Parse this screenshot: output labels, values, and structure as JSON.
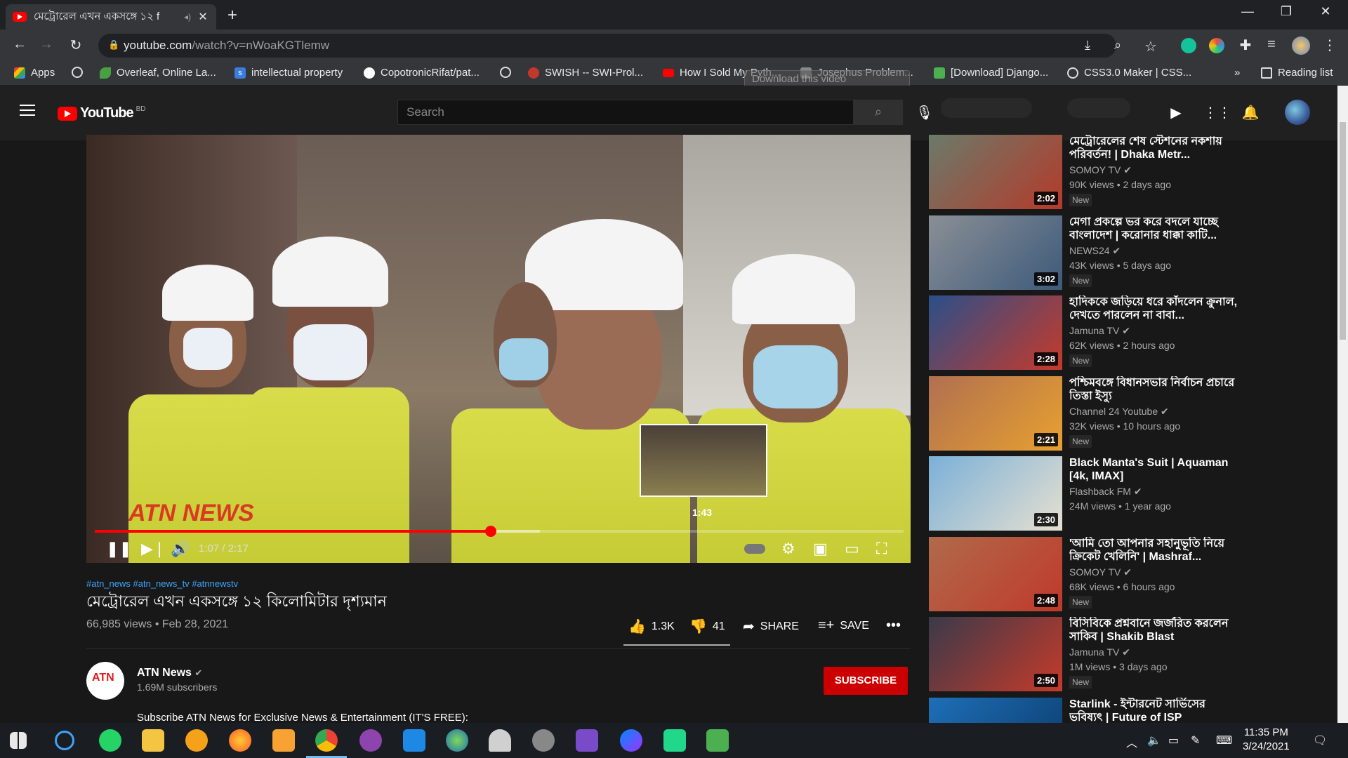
{
  "browser": {
    "tab_title": "মেট্রোরেল এখন একসঙ্গে ১২ f",
    "url_host": "youtube.com",
    "url_path": "/watch?v=nWoaKGTlemw",
    "reading_list": "Reading list",
    "bookmarks": [
      {
        "label": "Apps",
        "icon": "apps-grid-icon",
        "color": "#4285f4"
      },
      {
        "label": "",
        "icon": "globe-icon",
        "color": "#9aa0a6"
      },
      {
        "label": "Overleaf, Online La...",
        "icon": "overleaf-icon",
        "color": "#47a141"
      },
      {
        "label": "intellectual property",
        "icon": "s-icon",
        "color": "#3b7ddd"
      },
      {
        "label": "CopotronicRifat/pat...",
        "icon": "github-icon",
        "color": "#ffffff"
      },
      {
        "label": "",
        "icon": "globe-icon",
        "color": "#9aa0a6"
      },
      {
        "label": "SWISH -- SWI-Prol...",
        "icon": "swish-icon",
        "color": "#c0392b"
      },
      {
        "label": "How I Sold My Pyth...",
        "icon": "youtube-icon",
        "color": "#ff0000"
      },
      {
        "label": "Josephus Problem...",
        "icon": "bookmark-icon",
        "color": "#888888"
      },
      {
        "label": "[Download] Django...",
        "icon": "django-icon",
        "color": "#4caf50"
      },
      {
        "label": "CSS3.0 Maker | CSS...",
        "icon": "globe-icon",
        "color": "#9aa0a6"
      }
    ],
    "ghost_download": "Download this video"
  },
  "youtube": {
    "logo_text": "YouTube",
    "country": "BD",
    "search_placeholder": "Search"
  },
  "player": {
    "time": "1:07 / 2:17",
    "hover_time": "1:43",
    "progress": 0.49,
    "buffered": 0.55,
    "watermark": "ATN NEWS"
  },
  "video": {
    "hashtags": "#atn_news #atn_news_tv #atnnewstv",
    "title": "মেট্রোরেল এখন একসঙ্গে ১২ কিলোমিটার দৃশ্যমান",
    "meta": "66,985 views • Feb 28, 2021",
    "likes": "1.3K",
    "dislikes": "41",
    "share": "SHARE",
    "save": "SAVE",
    "channel": "ATN News",
    "subscribers": "1.69M subscribers",
    "subscribe": "SUBSCRIBE",
    "description": "Subscribe ATN News for Exclusive News & Entertainment (IT'S FREE):"
  },
  "recommendations": [
    {
      "title": "মেট্রোরেলের শেষ স্টেশনের নকশায় পরিবর্তন! | Dhaka Metr...",
      "channel": "SOMOY TV",
      "views": "90K views • 2 days ago",
      "badge": "New",
      "duration": "2:02",
      "colors": [
        "#6b7a6a",
        "#b43b2a"
      ]
    },
    {
      "title": "মেগা প্রকল্পে ভর করে বদলে যাচ্ছে বাংলাদেশ | করোনার ধাক্কা কাটি...",
      "channel": "NEWS24",
      "views": "43K views • 5 days ago",
      "badge": "New",
      "duration": "3:02",
      "colors": [
        "#8a8f96",
        "#3d5a7a"
      ]
    },
    {
      "title": "হাদিককে জড়িয়ে ধরে কাঁদলেন ক্রুনাল, দেখতে পারলেন না বাবা...",
      "channel": "Jamuna TV",
      "views": "62K views • 2 hours ago",
      "badge": "New",
      "duration": "2:28",
      "colors": [
        "#2a4f8a",
        "#c63a2a"
      ]
    },
    {
      "title": "পশ্চিমবঙ্গে বিধানসভার নির্বাচন প্রচারে তিস্তা ইস্যু",
      "channel": "Channel 24 Youtube",
      "views": "32K views • 10 hours ago",
      "badge": "New",
      "duration": "2:21",
      "colors": [
        "#b07050",
        "#e8a030"
      ]
    },
    {
      "title": "Black Manta's Suit | Aquaman [4k, IMAX]",
      "channel": "Flashback FM",
      "views": "24M views • 1 year ago",
      "badge": "",
      "duration": "2:30",
      "colors": [
        "#7bb0d8",
        "#e6e0d0"
      ]
    },
    {
      "title": "'আমি তো আপনার সহানুভূতি নিয়ে ক্রিকেট খেলিনি' | Mashraf...",
      "channel": "SOMOY TV",
      "views": "68K views • 6 hours ago",
      "badge": "New",
      "duration": "2:48",
      "colors": [
        "#b06a4a",
        "#c0392b"
      ]
    },
    {
      "title": "বিসিবিকে প্রশ্নবানে জর্জরিত করলেন সাকিব | Shakib Blast",
      "channel": "Jamuna TV",
      "views": "1M views • 3 days ago",
      "badge": "New",
      "duration": "2:50",
      "colors": [
        "#3a3a4a",
        "#c63a2a"
      ]
    },
    {
      "title": "Starlink - ইন্টারনেট সার্ভিসের ভবিষ্যৎ | Future of ISP",
      "channel": "",
      "views": "",
      "badge": "",
      "duration": "",
      "colors": [
        "#1e6fb8",
        "#0b3a6a"
      ]
    }
  ],
  "taskbar": {
    "time": "11:35 PM",
    "date": "3/24/2021"
  }
}
